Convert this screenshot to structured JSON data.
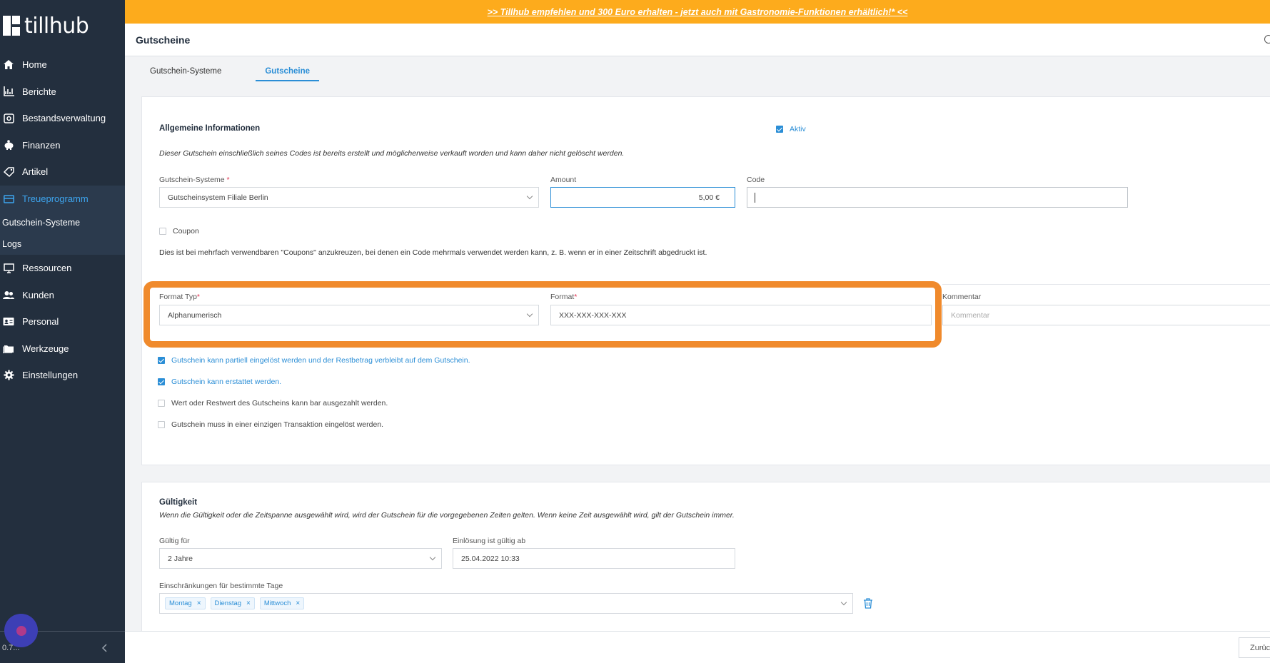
{
  "app": {
    "logo_text": "tillhub",
    "version": "0.7..."
  },
  "banner": {
    "text": ">> Tillhub empfehlen und 300 Euro erhalten - jetzt auch mit Gastronomie-Funktionen erhältlich!* <<"
  },
  "header": {
    "title": "Gutscheine"
  },
  "sidebar": {
    "items": [
      {
        "label": "Home"
      },
      {
        "label": "Berichte"
      },
      {
        "label": "Bestandsverwaltung"
      },
      {
        "label": "Finanzen"
      },
      {
        "label": "Artikel"
      },
      {
        "label": "Treueprogramm"
      },
      {
        "label": "Ressourcen"
      },
      {
        "label": "Kunden"
      },
      {
        "label": "Personal"
      },
      {
        "label": "Werkzeuge"
      },
      {
        "label": "Einstellungen"
      }
    ],
    "subitems": [
      {
        "label": "Gutschein-Systeme"
      },
      {
        "label": "Logs"
      }
    ]
  },
  "tabs": [
    {
      "label": "Gutschein-Systeme"
    },
    {
      "label": "Gutscheine"
    }
  ],
  "general": {
    "title": "Allgemeine Informationen",
    "active_label": "Aktiv",
    "note": "Dieser Gutschein einschließlich seines Codes ist bereits erstellt und möglicherweise verkauft worden und kann daher nicht gelöscht werden.",
    "system_label": "Gutschein-Systeme",
    "system_value": "Gutscheinsystem Filiale Berlin",
    "amount_label": "Amount",
    "amount_value": "5,00 €",
    "code_label": "Code",
    "coupon_label": "Coupon",
    "coupon_hint": "Dies ist bei mehrfach verwendbaren \"Coupons\" anzukreuzen, bei denen ein Code mehrmals verwendet werden kann, z. B. wenn er in einer Zeitschrift abgedruckt ist.",
    "format_type_label": "Format Typ",
    "format_type_value": "Alphanumerisch",
    "format_label": "Format",
    "format_value": "XXX-XXX-XXX-XXX",
    "comment_label": "Kommentar",
    "comment_placeholder": "Kommentar",
    "options": [
      {
        "label": "Gutschein kann partiell eingelöst werden und der Restbetrag verbleibt auf dem Gutschein.",
        "checked": true
      },
      {
        "label": "Gutschein kann erstattet werden.",
        "checked": true
      },
      {
        "label": "Wert oder Restwert des Gutscheins kann bar ausgezahlt werden.",
        "checked": false
      },
      {
        "label": "Gutschein muss in einer einzigen Transaktion eingelöst werden.",
        "checked": false
      }
    ]
  },
  "validity": {
    "title": "Gültigkeit",
    "note": "Wenn die Gültigkeit oder die Zeitspanne ausgewählt wird, wird der Gutschein für die vorgegebenen Zeiten gelten. Wenn keine Zeit ausgewählt wird, gilt der Gutschein immer.",
    "valid_for_label": "Gültig für",
    "valid_for_value": "2 Jahre",
    "redeem_from_label": "Einlösung ist gültig ab",
    "redeem_from_value": "25.04.2022 10:33",
    "restrictions_label": "Einschränkungen für bestimmte Tage",
    "days": [
      "Montag",
      "Dienstag",
      "Mittwoch"
    ]
  },
  "footer": {
    "back_label": "Zurüc"
  },
  "colors": {
    "sidebar": "#232f3e",
    "accent": "#2b8ed6",
    "banner": "#fdab1c",
    "highlight": "#f08a2c"
  }
}
